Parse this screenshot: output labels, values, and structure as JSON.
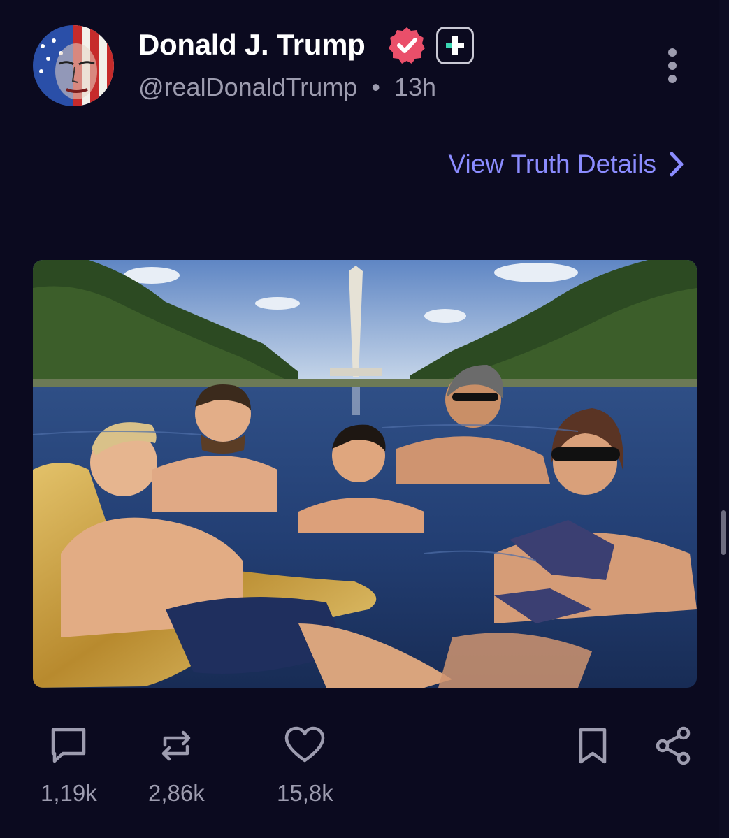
{
  "post": {
    "author": {
      "name": "Donald J. Trump",
      "handle": "@realDonaldTrump",
      "time": "13h",
      "separator": "•",
      "verified": true
    },
    "details_link": "View Truth Details",
    "image_description_icon": "photo",
    "actions": {
      "replies": "1,19k",
      "retruths": "2,86k",
      "likes": "15,8k"
    }
  },
  "colors": {
    "background": "#0b0a1f",
    "link": "#8b8cff",
    "verified": "#ea4f6a",
    "muted": "#9d9caf"
  }
}
